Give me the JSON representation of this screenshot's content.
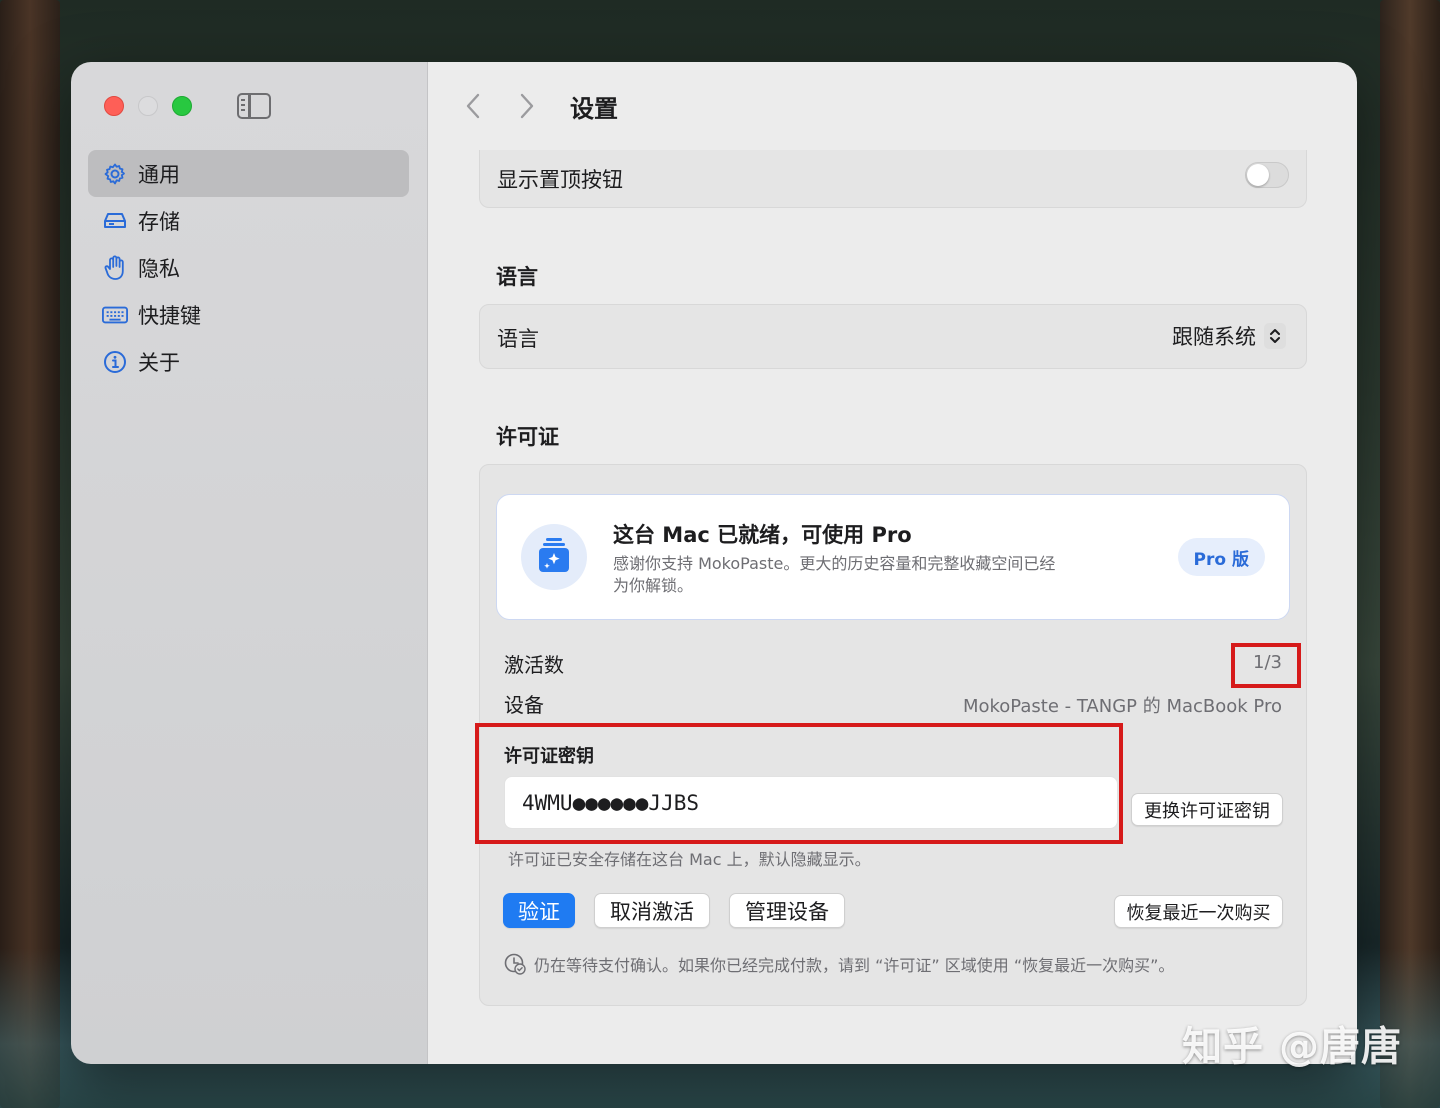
{
  "window": {
    "title": "设置"
  },
  "sidebar": {
    "items": [
      {
        "label": "通用",
        "icon": "gear-icon",
        "active": true
      },
      {
        "label": "存储",
        "icon": "drive-icon",
        "active": false
      },
      {
        "label": "隐私",
        "icon": "hand-icon",
        "active": false
      },
      {
        "label": "快捷键",
        "icon": "keyboard-icon",
        "active": false
      },
      {
        "label": "关于",
        "icon": "info-icon",
        "active": false
      }
    ]
  },
  "settings": {
    "pin_button_row": {
      "label": "显示置顶按钮",
      "enabled": false
    },
    "language_section": {
      "title": "语言",
      "row_label": "语言",
      "value": "跟随系统"
    },
    "license_section": {
      "title": "许可证",
      "pro_card": {
        "title": "这台 Mac 已就绪，可使用 Pro",
        "description": "感谢你支持 MokoPaste。更大的历史容量和完整收藏空间已经为你解锁。",
        "badge": "Pro 版"
      },
      "activations": {
        "label": "激活数",
        "value": "1/3"
      },
      "device": {
        "label": "设备",
        "value": "MokoPaste - TANGP 的 MacBook Pro"
      },
      "key": {
        "label": "许可证密钥",
        "value": "4WMU●●●●●●JJBS",
        "change_button": "更换许可证密钥",
        "hint": "许可证已安全存储在这台 Mac 上，默认隐藏显示。"
      },
      "buttons": {
        "verify": "验证",
        "deactivate": "取消激活",
        "manage_devices": "管理设备",
        "restore_purchase": "恢复最近一次购买"
      },
      "footnote": "仍在等待支付确认。如果你已经完成付款，请到 “许可证” 区域使用 “恢复最近一次购买”。"
    }
  },
  "watermark": "知乎 @唐唐",
  "colors": {
    "accent": "#1f7bf2",
    "highlight": "#d61a1a"
  }
}
